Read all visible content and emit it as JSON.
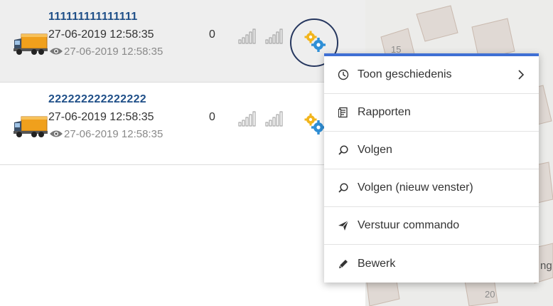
{
  "vehicles": [
    {
      "name": "111111111111111",
      "time": "27-06-2019 12:58:35",
      "count": "0",
      "last_seen": "27-06-2019 12:58:35",
      "selected": true
    },
    {
      "name": "222222222222222",
      "time": "27-06-2019 12:58:35",
      "count": "0",
      "last_seen": "27-06-2019 12:58:35",
      "selected": false
    }
  ],
  "icons": {
    "vehicle": "truck-icon",
    "signal": "signal-bars-icon",
    "settings": "gears-icon",
    "seen": "eye-icon"
  },
  "context_menu": {
    "items": [
      {
        "label": "Toon geschiedenis",
        "icon": "clock-icon",
        "has_submenu": true
      },
      {
        "label": "Rapporten",
        "icon": "report-icon"
      },
      {
        "label": "Volgen",
        "icon": "search-icon"
      },
      {
        "label": "Volgen (nieuw venster)",
        "icon": "search-icon"
      },
      {
        "label": "Verstuur commando",
        "icon": "send-icon"
      },
      {
        "label": "Bewerk",
        "icon": "pencil-icon"
      }
    ]
  },
  "map": {
    "labels": [
      "15",
      "20",
      "ng"
    ]
  },
  "colors": {
    "accent": "#3f6fd4",
    "vehicle_name": "#1f4f88",
    "highlight_ring": "#26375f",
    "truck": "#f0a01c"
  }
}
